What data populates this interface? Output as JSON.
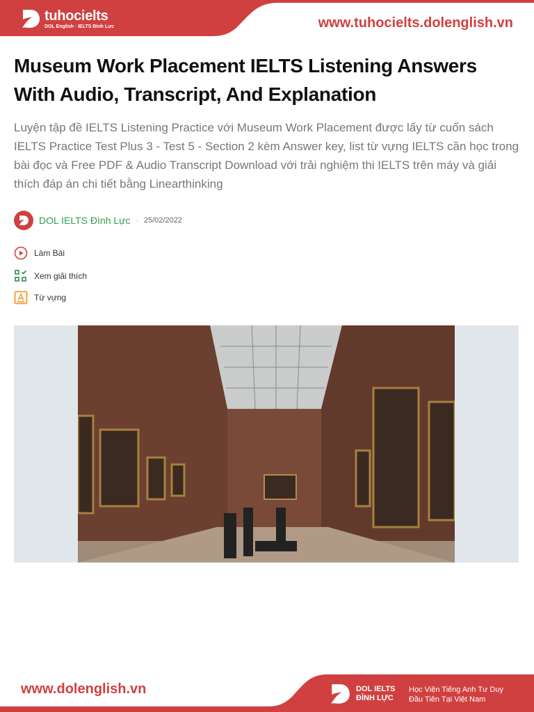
{
  "header": {
    "logo_name": "tuhocielts",
    "logo_sub": "DOL English · IELTS Đình Lực",
    "site_url": "www.tuhocielts.dolenglish.vn"
  },
  "article": {
    "title": "Museum Work Placement IELTS Listening Answers With Audio, Transcript, And Explanation",
    "description": "Luyện tập đề IELTS Listening Practice với Museum Work Placement được lấy từ cuốn sách IELTS Practice Test Plus 3 - Test 5 - Section 2 kèm Answer key, list từ vựng IELTS cần học trong bài đọc và Free PDF & Audio Transcript Download với trải nghiệm thi IELTS trên máy và giải thích đáp án chi tiết bằng Linearthinking",
    "author": "DOL IELTS Đình Lực",
    "separator": "·",
    "date": "25/02/2022",
    "actions": [
      {
        "label": "Làm Bài",
        "icon": "play-circle-icon"
      },
      {
        "label": "Xem giải thích",
        "icon": "checklist-icon"
      },
      {
        "label": "Từ vựng",
        "icon": "vocabulary-icon"
      }
    ]
  },
  "footer": {
    "url": "www.dolenglish.vn",
    "brand_line1": "DOL IELTS",
    "brand_line2": "ĐÌNH LỰC",
    "tagline_line1": "Học Viện Tiếng Anh Tư Duy",
    "tagline_line2": "Đầu Tiên Tại Việt Nam"
  },
  "colors": {
    "brand_red": "#d04040",
    "author_green": "#2e9e4c",
    "vocab_orange": "#f39a2b"
  }
}
